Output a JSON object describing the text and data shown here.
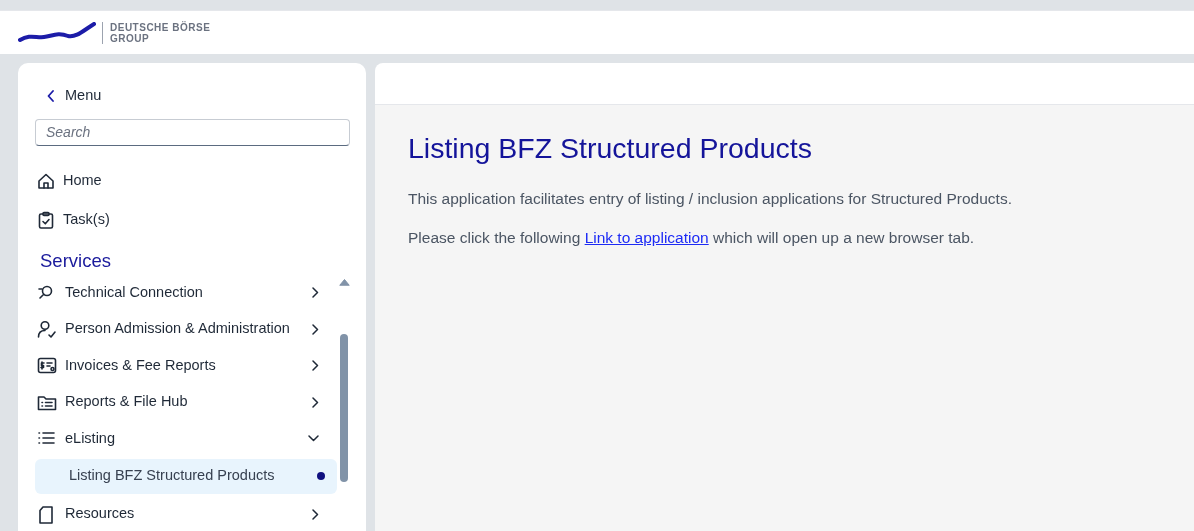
{
  "logo": {
    "line_1": "DEUTSCHE BÖRSE",
    "line_2": "GROUP"
  },
  "sidebar": {
    "back_label": "Menu",
    "search": {
      "placeholder": "Search"
    },
    "items": [
      {
        "label": "Home"
      },
      {
        "label": "Task(s)"
      }
    ],
    "section_title": "Services",
    "services": [
      {
        "label": "Technical Connection",
        "expanded": false
      },
      {
        "label": "Person Admission & Administration",
        "expanded": false
      },
      {
        "label": "Invoices & Fee Reports",
        "expanded": false
      },
      {
        "label": "Reports & File Hub",
        "expanded": false
      },
      {
        "label": "eListing",
        "expanded": true,
        "children": [
          {
            "label": "Listing BFZ Structured Products",
            "selected": true
          }
        ]
      },
      {
        "label": "Resources",
        "expanded": false
      }
    ]
  },
  "main": {
    "title": "Listing BFZ Structured Products",
    "paragraphs": [
      {
        "text": "This application facilitates entry of listing / inclusion applications for Structured Products."
      },
      {
        "before": "Please click the following ",
        "link": "Link to application",
        "after": " which will open up a new browser tab."
      }
    ]
  }
}
